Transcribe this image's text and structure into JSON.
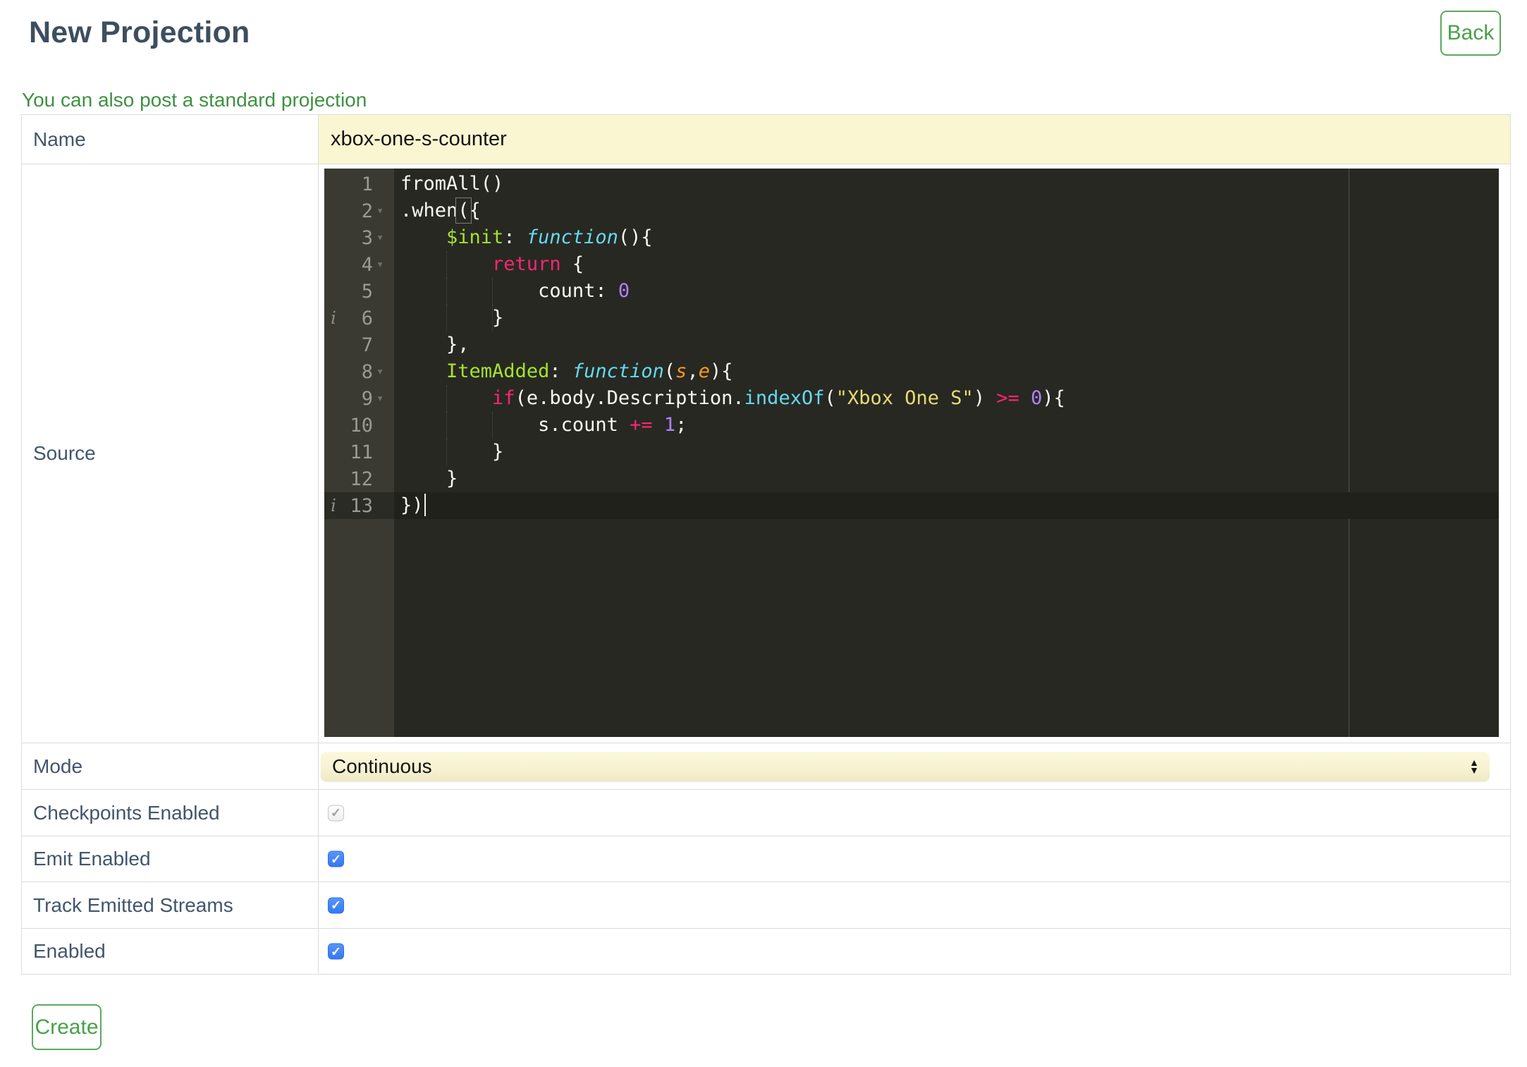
{
  "header": {
    "title": "New Projection",
    "back_label": "Back"
  },
  "link_text": "You can also post a standard projection",
  "form": {
    "rows": [
      {
        "label": "Name"
      },
      {
        "label": "Source"
      },
      {
        "label": "Mode"
      },
      {
        "label": "Checkpoints Enabled"
      },
      {
        "label": "Emit Enabled"
      },
      {
        "label": "Track Emitted Streams"
      },
      {
        "label": "Enabled"
      }
    ],
    "name_value": "xbox-one-s-counter",
    "mode_value": "Continuous",
    "checkboxes": {
      "checkpoints_enabled": {
        "checked": true,
        "disabled": true
      },
      "emit_enabled": {
        "checked": true,
        "disabled": false
      },
      "track_emitted_streams": {
        "checked": true,
        "disabled": false
      },
      "enabled": {
        "checked": true,
        "disabled": false
      }
    },
    "create_label": "Create"
  },
  "icons": {
    "select_stepper_up": "▲",
    "select_stepper_down": "▼",
    "checkbox_check": "✓",
    "fold_arrow": "▾",
    "info_annotation": "i"
  },
  "colors": {
    "accent_green": "#49a049",
    "label_text": "#42566c",
    "input_yellow": "#faf6d2",
    "checkbox_blue": "#3c7ef5",
    "editor_background": "#272822",
    "editor_gutter": "#3a3a32",
    "editor_active_line": "#20211b",
    "syntax_keyword": "#f92672",
    "syntax_entity": "#a6e22e",
    "syntax_storage": "#66d9ef",
    "syntax_string": "#e6db74",
    "syntax_number": "#ae81ff",
    "syntax_param": "#fd971f"
  },
  "editor": {
    "lines": [
      {
        "n": 1,
        "segs": [
          [
            "t",
            "fromAll()"
          ]
        ]
      },
      {
        "n": 2,
        "fold": true,
        "segs": [
          [
            "t",
            ".when"
          ],
          [
            "br",
            "("
          ],
          [
            "t",
            "{"
          ]
        ]
      },
      {
        "n": 3,
        "fold": true,
        "segs": [
          [
            "t",
            "    "
          ],
          [
            "e",
            "$init"
          ],
          [
            "t",
            ": "
          ],
          [
            "s",
            "function"
          ],
          [
            "t",
            "(){"
          ]
        ]
      },
      {
        "n": 4,
        "fold": true,
        "guides": [
          4
        ],
        "segs": [
          [
            "t",
            "        "
          ],
          [
            "k",
            "return"
          ],
          [
            "t",
            " {"
          ]
        ]
      },
      {
        "n": 5,
        "guides": [
          4,
          8
        ],
        "segs": [
          [
            "t",
            "            count: "
          ],
          [
            "n",
            "0"
          ]
        ]
      },
      {
        "n": 6,
        "info": true,
        "guides": [
          4,
          8
        ],
        "segs": [
          [
            "t",
            "        }"
          ]
        ]
      },
      {
        "n": 7,
        "segs": [
          [
            "t",
            "    },"
          ]
        ]
      },
      {
        "n": 8,
        "fold": true,
        "segs": [
          [
            "t",
            "    "
          ],
          [
            "e",
            "ItemAdded"
          ],
          [
            "t",
            ": "
          ],
          [
            "s",
            "function"
          ],
          [
            "t",
            "("
          ],
          [
            "p",
            "s"
          ],
          [
            "t",
            ","
          ],
          [
            "p",
            "e"
          ],
          [
            "t",
            "){"
          ]
        ]
      },
      {
        "n": 9,
        "fold": true,
        "guides": [
          4
        ],
        "segs": [
          [
            "t",
            "        "
          ],
          [
            "k",
            "if"
          ],
          [
            "t",
            "(e.body.Description."
          ],
          [
            "f",
            "indexOf"
          ],
          [
            "t",
            "("
          ],
          [
            "str",
            "\"Xbox One S\""
          ],
          [
            "t",
            ") "
          ],
          [
            "k",
            ">="
          ],
          [
            "t",
            " "
          ],
          [
            "n",
            "0"
          ],
          [
            "t",
            "){"
          ]
        ]
      },
      {
        "n": 10,
        "guides": [
          4,
          8
        ],
        "segs": [
          [
            "t",
            "            s.count "
          ],
          [
            "k",
            "+="
          ],
          [
            "t",
            " "
          ],
          [
            "n",
            "1"
          ],
          [
            "t",
            ";"
          ]
        ]
      },
      {
        "n": 11,
        "guides": [
          4
        ],
        "segs": [
          [
            "t",
            "        }"
          ]
        ]
      },
      {
        "n": 12,
        "segs": [
          [
            "t",
            "    }"
          ]
        ]
      },
      {
        "n": 13,
        "info": true,
        "active": true,
        "cursor": true,
        "segs": [
          [
            "t",
            "})"
          ]
        ]
      }
    ]
  }
}
